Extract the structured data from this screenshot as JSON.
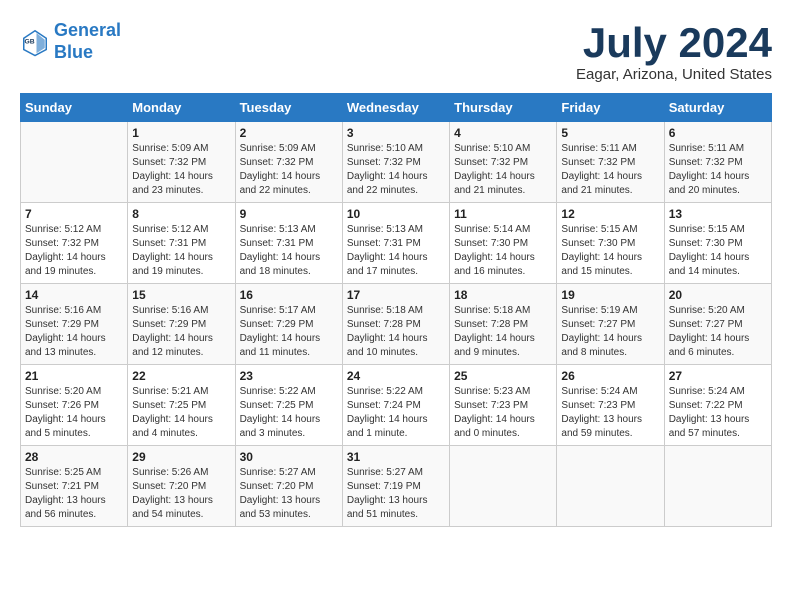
{
  "header": {
    "logo_line1": "General",
    "logo_line2": "Blue",
    "month_title": "July 2024",
    "location": "Eagar, Arizona, United States"
  },
  "days_of_week": [
    "Sunday",
    "Monday",
    "Tuesday",
    "Wednesday",
    "Thursday",
    "Friday",
    "Saturday"
  ],
  "weeks": [
    [
      {
        "day": "",
        "info": ""
      },
      {
        "day": "1",
        "info": "Sunrise: 5:09 AM\nSunset: 7:32 PM\nDaylight: 14 hours\nand 23 minutes."
      },
      {
        "day": "2",
        "info": "Sunrise: 5:09 AM\nSunset: 7:32 PM\nDaylight: 14 hours\nand 22 minutes."
      },
      {
        "day": "3",
        "info": "Sunrise: 5:10 AM\nSunset: 7:32 PM\nDaylight: 14 hours\nand 22 minutes."
      },
      {
        "day": "4",
        "info": "Sunrise: 5:10 AM\nSunset: 7:32 PM\nDaylight: 14 hours\nand 21 minutes."
      },
      {
        "day": "5",
        "info": "Sunrise: 5:11 AM\nSunset: 7:32 PM\nDaylight: 14 hours\nand 21 minutes."
      },
      {
        "day": "6",
        "info": "Sunrise: 5:11 AM\nSunset: 7:32 PM\nDaylight: 14 hours\nand 20 minutes."
      }
    ],
    [
      {
        "day": "7",
        "info": "Sunrise: 5:12 AM\nSunset: 7:32 PM\nDaylight: 14 hours\nand 19 minutes."
      },
      {
        "day": "8",
        "info": "Sunrise: 5:12 AM\nSunset: 7:31 PM\nDaylight: 14 hours\nand 19 minutes."
      },
      {
        "day": "9",
        "info": "Sunrise: 5:13 AM\nSunset: 7:31 PM\nDaylight: 14 hours\nand 18 minutes."
      },
      {
        "day": "10",
        "info": "Sunrise: 5:13 AM\nSunset: 7:31 PM\nDaylight: 14 hours\nand 17 minutes."
      },
      {
        "day": "11",
        "info": "Sunrise: 5:14 AM\nSunset: 7:30 PM\nDaylight: 14 hours\nand 16 minutes."
      },
      {
        "day": "12",
        "info": "Sunrise: 5:15 AM\nSunset: 7:30 PM\nDaylight: 14 hours\nand 15 minutes."
      },
      {
        "day": "13",
        "info": "Sunrise: 5:15 AM\nSunset: 7:30 PM\nDaylight: 14 hours\nand 14 minutes."
      }
    ],
    [
      {
        "day": "14",
        "info": "Sunrise: 5:16 AM\nSunset: 7:29 PM\nDaylight: 14 hours\nand 13 minutes."
      },
      {
        "day": "15",
        "info": "Sunrise: 5:16 AM\nSunset: 7:29 PM\nDaylight: 14 hours\nand 12 minutes."
      },
      {
        "day": "16",
        "info": "Sunrise: 5:17 AM\nSunset: 7:29 PM\nDaylight: 14 hours\nand 11 minutes."
      },
      {
        "day": "17",
        "info": "Sunrise: 5:18 AM\nSunset: 7:28 PM\nDaylight: 14 hours\nand 10 minutes."
      },
      {
        "day": "18",
        "info": "Sunrise: 5:18 AM\nSunset: 7:28 PM\nDaylight: 14 hours\nand 9 minutes."
      },
      {
        "day": "19",
        "info": "Sunrise: 5:19 AM\nSunset: 7:27 PM\nDaylight: 14 hours\nand 8 minutes."
      },
      {
        "day": "20",
        "info": "Sunrise: 5:20 AM\nSunset: 7:27 PM\nDaylight: 14 hours\nand 6 minutes."
      }
    ],
    [
      {
        "day": "21",
        "info": "Sunrise: 5:20 AM\nSunset: 7:26 PM\nDaylight: 14 hours\nand 5 minutes."
      },
      {
        "day": "22",
        "info": "Sunrise: 5:21 AM\nSunset: 7:25 PM\nDaylight: 14 hours\nand 4 minutes."
      },
      {
        "day": "23",
        "info": "Sunrise: 5:22 AM\nSunset: 7:25 PM\nDaylight: 14 hours\nand 3 minutes."
      },
      {
        "day": "24",
        "info": "Sunrise: 5:22 AM\nSunset: 7:24 PM\nDaylight: 14 hours\nand 1 minute."
      },
      {
        "day": "25",
        "info": "Sunrise: 5:23 AM\nSunset: 7:23 PM\nDaylight: 14 hours\nand 0 minutes."
      },
      {
        "day": "26",
        "info": "Sunrise: 5:24 AM\nSunset: 7:23 PM\nDaylight: 13 hours\nand 59 minutes."
      },
      {
        "day": "27",
        "info": "Sunrise: 5:24 AM\nSunset: 7:22 PM\nDaylight: 13 hours\nand 57 minutes."
      }
    ],
    [
      {
        "day": "28",
        "info": "Sunrise: 5:25 AM\nSunset: 7:21 PM\nDaylight: 13 hours\nand 56 minutes."
      },
      {
        "day": "29",
        "info": "Sunrise: 5:26 AM\nSunset: 7:20 PM\nDaylight: 13 hours\nand 54 minutes."
      },
      {
        "day": "30",
        "info": "Sunrise: 5:27 AM\nSunset: 7:20 PM\nDaylight: 13 hours\nand 53 minutes."
      },
      {
        "day": "31",
        "info": "Sunrise: 5:27 AM\nSunset: 7:19 PM\nDaylight: 13 hours\nand 51 minutes."
      },
      {
        "day": "",
        "info": ""
      },
      {
        "day": "",
        "info": ""
      },
      {
        "day": "",
        "info": ""
      }
    ]
  ]
}
